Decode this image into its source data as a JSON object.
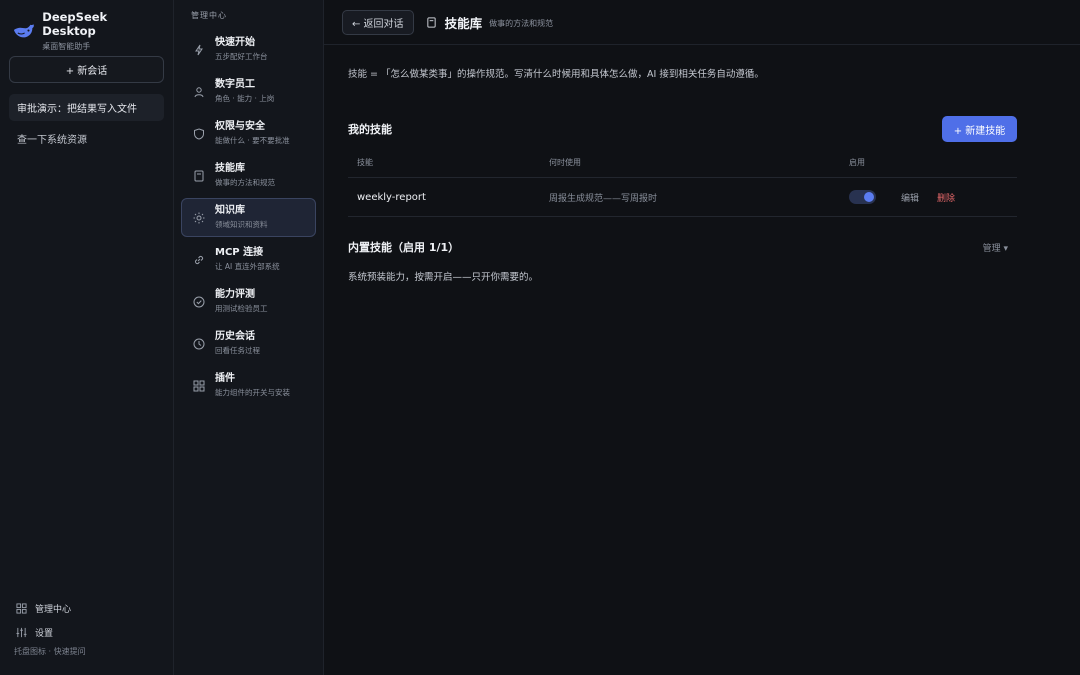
{
  "brand": {
    "title": "DeepSeek Desktop",
    "subtitle": "桌面智能助手"
  },
  "sidebar": {
    "new_chat": "+ 新会话",
    "conversations": [
      {
        "label": "审批演示：把结果写入文件",
        "active": true
      },
      {
        "label": "查一下系统资源",
        "active": false
      }
    ],
    "bottom": {
      "admin": "管理中心",
      "settings": "设置",
      "hint": "托盘图标 · 快速提问"
    }
  },
  "nav": {
    "header": "管理中心",
    "items": [
      {
        "title": "快速开始",
        "sub": "五步配好工作台",
        "icon": "lightning-icon"
      },
      {
        "title": "数字员工",
        "sub": "角色 · 能力 · 上岗",
        "icon": "person-icon"
      },
      {
        "title": "权限与安全",
        "sub": "能做什么 · 要不要批准",
        "icon": "shield-icon"
      },
      {
        "title": "技能库",
        "sub": "做事的方法和规范",
        "icon": "book-icon"
      },
      {
        "title": "知识库",
        "sub": "领域知识和资料",
        "icon": "sun-icon",
        "active": true
      },
      {
        "title": "MCP 连接",
        "sub": "让 AI 直连外部系统",
        "icon": "link-icon"
      },
      {
        "title": "能力评测",
        "sub": "用测试检验员工",
        "icon": "check-circle-icon"
      },
      {
        "title": "历史会话",
        "sub": "回看任务过程",
        "icon": "clock-icon"
      },
      {
        "title": "插件",
        "sub": "能力组件的开关与安装",
        "icon": "grid-icon"
      }
    ]
  },
  "header": {
    "back": "← 返回对话",
    "title": "技能库",
    "subtitle": "做事的方法和规范"
  },
  "main": {
    "intro": "技能 = 「怎么做某类事」的操作规范。写清什么时候用和具体怎么做，AI 接到相关任务自动遵循。",
    "my_skills": {
      "title": "我的技能",
      "new_button": "+ 新建技能",
      "columns": [
        "技能",
        "何时使用",
        "启用"
      ],
      "rows": [
        {
          "name": "weekly-report",
          "when": "周报生成规范——写周报时",
          "enabled": true,
          "edit": "编辑",
          "delete": "删除"
        }
      ]
    },
    "builtin": {
      "title": "内置技能（启用 1/1）",
      "manage": "管理 ▾",
      "desc": "系统预装能力，按需开启——只开你需要的。"
    }
  },
  "colors": {
    "accent": "#4f6fe8",
    "danger": "#e5686a",
    "bg": "#0f1115",
    "panel": "#13161c"
  }
}
